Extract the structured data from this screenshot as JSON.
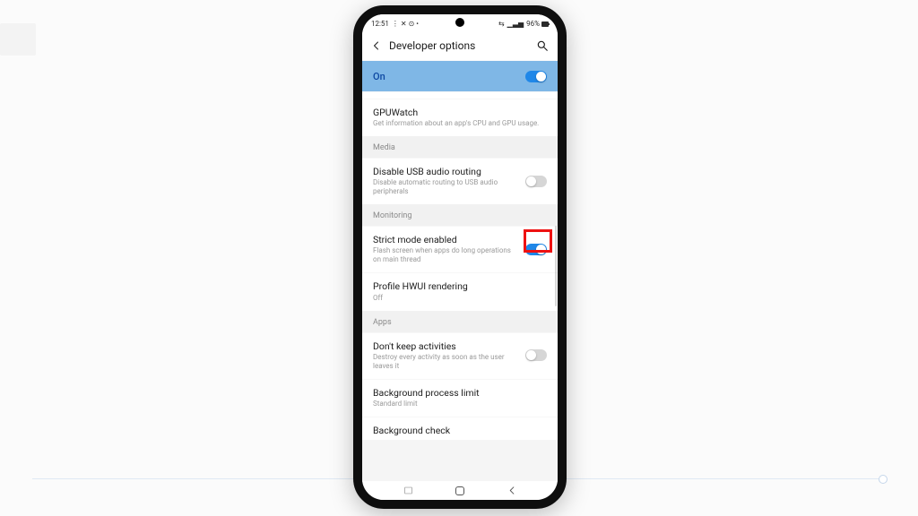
{
  "statusbar": {
    "time": "12:51",
    "left_indicators": "⋮ ✕ ⊙ •",
    "right_indicators": "⇆",
    "wifi": "📶",
    "battery_pct": "96%"
  },
  "header": {
    "title": "Developer options"
  },
  "master_toggle": {
    "label": "On",
    "on": true
  },
  "sections": {
    "partial_top_row": {
      "title": "GPUWatch",
      "subtitle": "Get information about an app's CPU and GPU usage."
    },
    "media": {
      "label": "Media",
      "rows": [
        {
          "title": "Disable USB audio routing",
          "subtitle": "Disable automatic routing to USB audio peripherals",
          "toggle": {
            "on": false
          }
        }
      ]
    },
    "monitoring": {
      "label": "Monitoring",
      "rows": [
        {
          "title": "Strict mode enabled",
          "subtitle": "Flash screen when apps do long operations on main thread",
          "toggle": {
            "on": true
          },
          "highlight": true
        },
        {
          "title": "Profile HWUI rendering",
          "subtitle": "Off"
        }
      ]
    },
    "apps": {
      "label": "Apps",
      "rows": [
        {
          "title": "Don't keep activities",
          "subtitle": "Destroy every activity as soon as the user leaves it",
          "toggle": {
            "on": false
          }
        },
        {
          "title": "Background process limit",
          "subtitle": "Standard limit"
        },
        {
          "title": "Background check",
          "subtitle": ""
        }
      ]
    }
  },
  "colors": {
    "accent": "#1f87e8",
    "banner": "#7fb7e6",
    "highlight": "#e11313"
  }
}
